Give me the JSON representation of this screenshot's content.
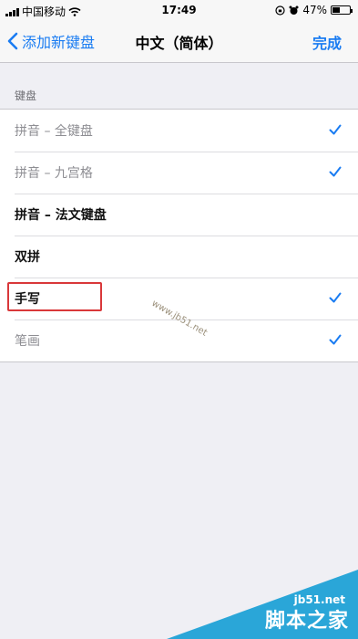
{
  "status_bar": {
    "carrier": "中国移动",
    "time": "17:49",
    "battery": "47%",
    "battery_level": 0.47
  },
  "nav": {
    "back_label": "添加新键盘",
    "title": "中文（简体）",
    "done_label": "完成"
  },
  "section": {
    "header": "键盘"
  },
  "rows": [
    {
      "label": "拼音 – 全键盘",
      "checked": true,
      "style": "muted"
    },
    {
      "label": "拼音 – 九宫格",
      "checked": true,
      "style": "muted"
    },
    {
      "label": "拼音 – 法文键盘",
      "checked": false,
      "style": "bold"
    },
    {
      "label": "双拼",
      "checked": false,
      "style": "bold"
    },
    {
      "label": "手写",
      "checked": true,
      "style": "bold"
    },
    {
      "label": "笔画",
      "checked": true,
      "style": "muted"
    }
  ],
  "watermark": {
    "inline_url": "www.jb51.net",
    "corner_url": "jb51.net",
    "corner_name": "脚本之家"
  },
  "colors": {
    "accent": "#1a7cf2",
    "highlight": "#d9383a",
    "watermark": "#2aa6d8"
  }
}
